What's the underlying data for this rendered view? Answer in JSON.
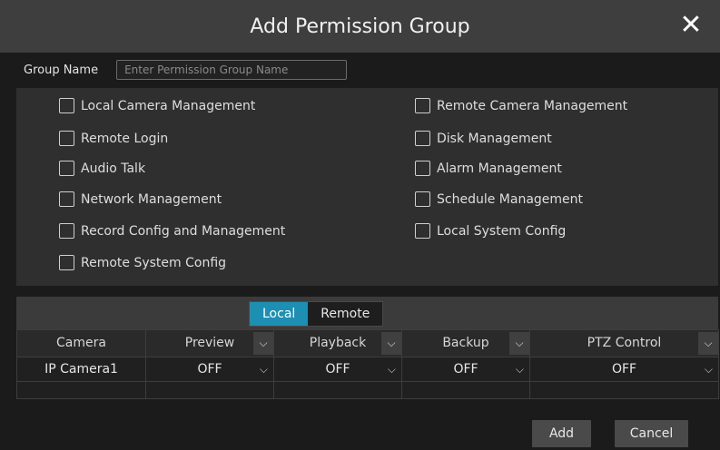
{
  "dialog": {
    "title": "Add Permission Group",
    "close_symbol": "✕"
  },
  "group_name": {
    "label": "Group Name",
    "placeholder": "Enter Permission Group Name",
    "value": ""
  },
  "permissions": {
    "left": [
      {
        "label": "Local Camera Management",
        "checked": false
      },
      {
        "label": "Remote Login",
        "checked": false
      },
      {
        "label": "Audio Talk",
        "checked": false
      },
      {
        "label": "Network Management",
        "checked": false
      },
      {
        "label": "Record Config and Management",
        "checked": false
      },
      {
        "label": "Remote System Config",
        "checked": false
      }
    ],
    "right": [
      {
        "label": "Remote Camera Management",
        "checked": false
      },
      {
        "label": "Disk Management",
        "checked": false
      },
      {
        "label": "Alarm Management",
        "checked": false
      },
      {
        "label": "Schedule Management",
        "checked": false
      },
      {
        "label": "Local System Config",
        "checked": false
      }
    ]
  },
  "tabs": [
    {
      "label": "Local",
      "active": true
    },
    {
      "label": "Remote",
      "active": false
    }
  ],
  "table": {
    "columns": [
      "Camera",
      "Preview",
      "Playback",
      "Backup",
      "PTZ Control"
    ],
    "rows": [
      {
        "camera": "IP Camera1",
        "preview": "OFF",
        "playback": "OFF",
        "backup": "OFF",
        "ptz": "OFF"
      }
    ]
  },
  "buttons": {
    "add": "Add",
    "cancel": "Cancel"
  },
  "icons": {
    "chevron": "chevron-down-icon",
    "close": "close-icon",
    "checkbox": "checkbox-unchecked"
  },
  "colors": {
    "accent": "#1d8fb3",
    "background": "#1b1b1b",
    "header": "#3e3e3e"
  }
}
